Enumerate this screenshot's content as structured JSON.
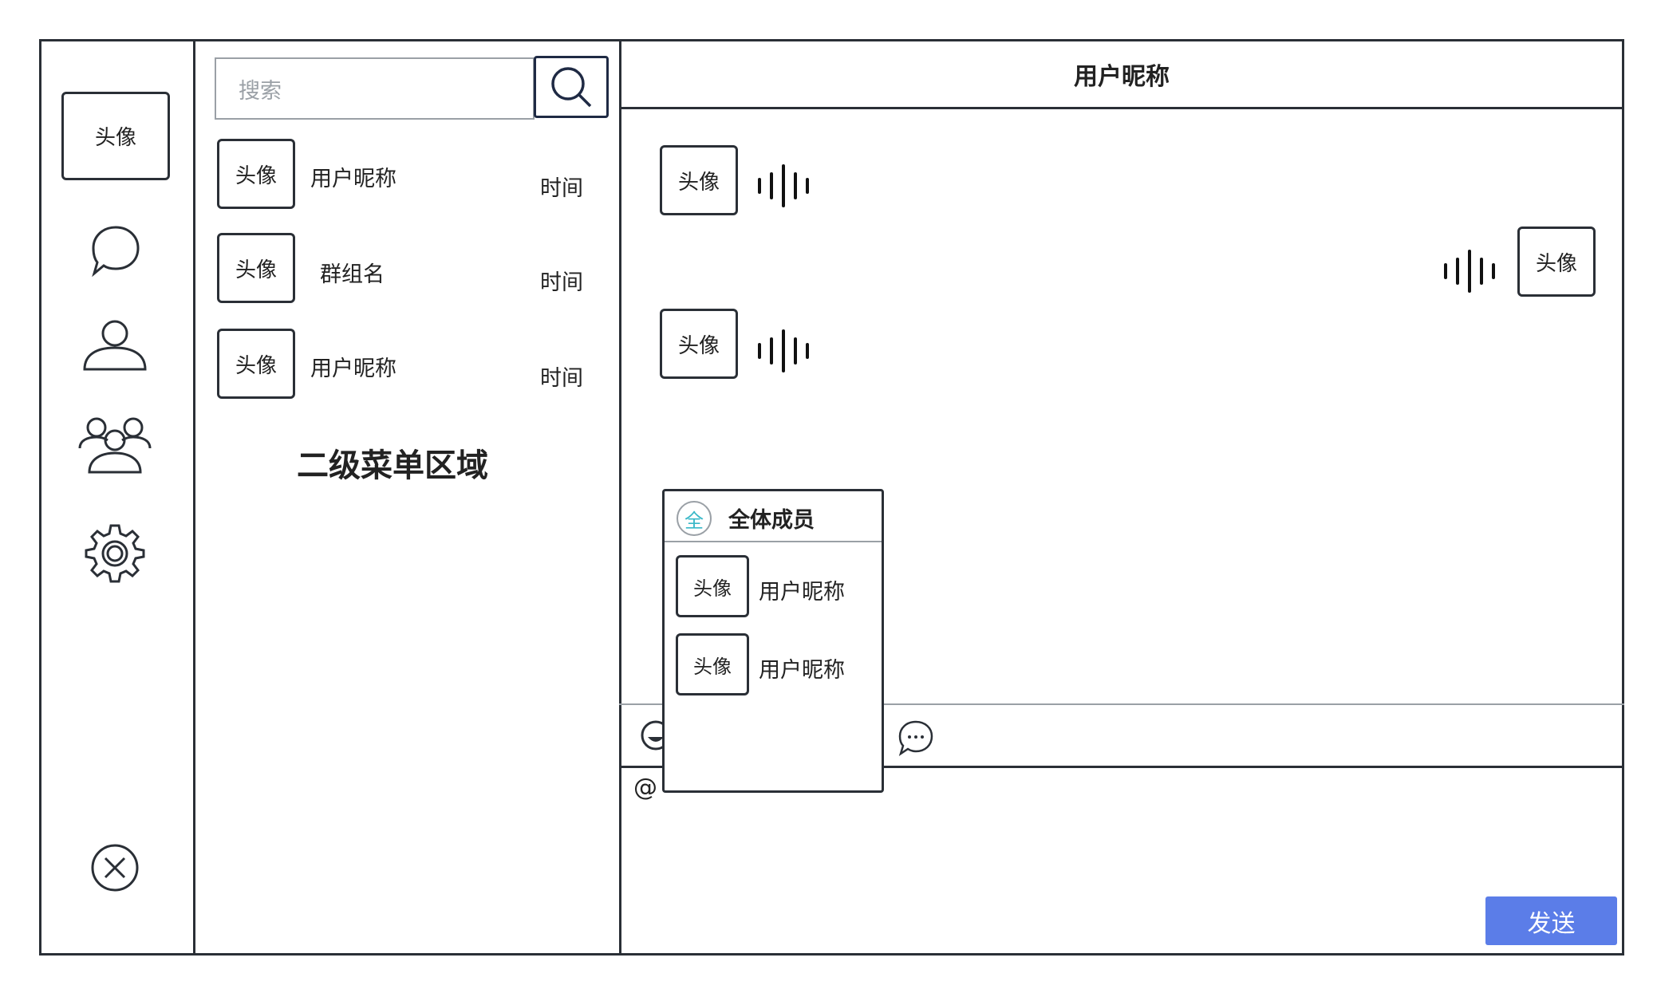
{
  "sidebar": {
    "avatar_label": "头像",
    "icons": [
      "chat-icon",
      "user-icon",
      "group-icon",
      "gear-icon",
      "close-icon"
    ]
  },
  "secondary_menu": {
    "search_placeholder": "搜索",
    "items": [
      {
        "avatar": "头像",
        "name": "用户昵称",
        "time": "时间"
      },
      {
        "avatar": "头像",
        "name": "群组名",
        "time": "时间"
      },
      {
        "avatar": "头像",
        "name": "用户昵称",
        "time": "时间"
      }
    ],
    "area_label": "二级菜单区域"
  },
  "chat": {
    "title": "用户昵称",
    "messages": [
      {
        "side": "left",
        "avatar": "头像",
        "type": "voice"
      },
      {
        "side": "right",
        "avatar": "头像",
        "type": "voice"
      },
      {
        "side": "left",
        "avatar": "头像",
        "type": "voice"
      }
    ],
    "mention_popup": {
      "all_badge": "全",
      "all_label": "全体成员",
      "members": [
        {
          "avatar": "头像",
          "name": "用户昵称"
        },
        {
          "avatar": "头像",
          "name": "用户昵称"
        }
      ]
    },
    "input_text": "@",
    "send_label": "发送",
    "colors": {
      "send_button": "#5b7de8",
      "all_badge": "#39b8c8"
    }
  }
}
